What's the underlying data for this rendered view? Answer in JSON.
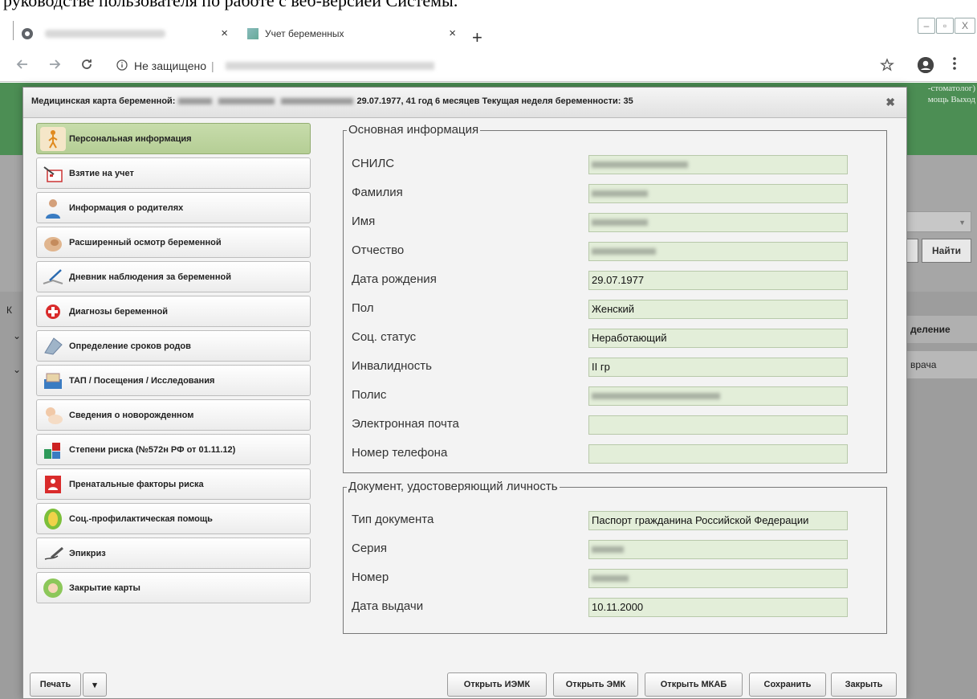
{
  "document_text": "руководстве пользователя по работе с веб-версией Системы.",
  "browser": {
    "tab1_favicon": "globe-icon",
    "tab2_title": "Учет беременных",
    "tab_close": "×",
    "new_tab": "+",
    "address_secure_label": "Не защищено",
    "separator": "|",
    "win_min": "–",
    "win_max": "▫",
    "win_close": "X"
  },
  "background_app": {
    "top_right_line1": "-стоматолог)",
    "top_right_line2": "мощь  Выход",
    "find_label": "Найти",
    "side_label": "К",
    "col_header": "деление",
    "row_value": "врача"
  },
  "modal": {
    "title_prefix": "Медицинская карта беременной:",
    "title_suffix": "29.07.1977, 41 год 6 месяцев Текущая неделя беременности: 35",
    "close_label": "✖",
    "nav_items": [
      {
        "label": "Персональная информация",
        "icon": "person-walking-icon",
        "active": true
      },
      {
        "label": "Взятие на учет",
        "icon": "registration-calendar-icon",
        "active": false
      },
      {
        "label": "Информация о родителях",
        "icon": "parent-person-icon",
        "active": false
      },
      {
        "label": "Расширенный осмотр беременной",
        "icon": "pregnant-belly-icon",
        "active": false
      },
      {
        "label": "Дневник наблюдения за беременной",
        "icon": "diary-pen-icon",
        "active": false
      },
      {
        "label": "Диагнозы беременной",
        "icon": "medical-cross-icon",
        "active": false
      },
      {
        "label": "Определение сроков родов",
        "icon": "calculator-icon",
        "active": false
      },
      {
        "label": "ТАП / Посещения / Исследования",
        "icon": "card-file-icon",
        "active": false
      },
      {
        "label": "Сведения о новорожденном",
        "icon": "newborn-icon",
        "active": false
      },
      {
        "label": "Степени риска (№572н РФ от 01.11.12)",
        "icon": "risk-chart-icon",
        "active": false
      },
      {
        "label": "Пренатальные факторы риска",
        "icon": "prenatal-risk-icon",
        "active": false
      },
      {
        "label": "Соц.-профилактическая помощь",
        "icon": "leaf-shield-icon",
        "active": false
      },
      {
        "label": "Эпикриз",
        "icon": "pen-signature-icon",
        "active": false
      },
      {
        "label": "Закрытие карты",
        "icon": "baby-flower-icon",
        "active": false
      }
    ],
    "main_info": {
      "legend": "Основная информация",
      "snils_label": "СНИЛС",
      "lastname_label": "Фамилия",
      "firstname_label": "Имя",
      "patronymic_label": "Отчество",
      "birthdate_label": "Дата рождения",
      "birthdate_value": "29.07.1977",
      "sex_label": "Пол",
      "sex_value": "Женский",
      "social_label": "Соц. статус",
      "social_value": "Неработающий",
      "disability_label": "Инвалидность",
      "disability_value": "II гр",
      "policy_label": "Полис",
      "email_label": "Электронная почта",
      "email_value": "",
      "phone_label": "Номер телефона",
      "phone_value": ""
    },
    "identity_doc": {
      "legend": "Документ, удостоверяющий личность",
      "type_label": "Тип документа",
      "type_value": "Паспорт гражданина Российской Федерации",
      "series_label": "Серия",
      "number_label": "Номер",
      "issue_date_label": "Дата выдачи",
      "issue_date_value": "10.11.2000"
    },
    "buttons": {
      "print": "Печать",
      "print_dropdown": "▾",
      "open_iemk": "Открыть ИЭМК",
      "open_emk": "Открыть ЭМК",
      "open_mkab": "Открыть МКАБ",
      "save": "Сохранить",
      "close": "Закрыть"
    }
  }
}
